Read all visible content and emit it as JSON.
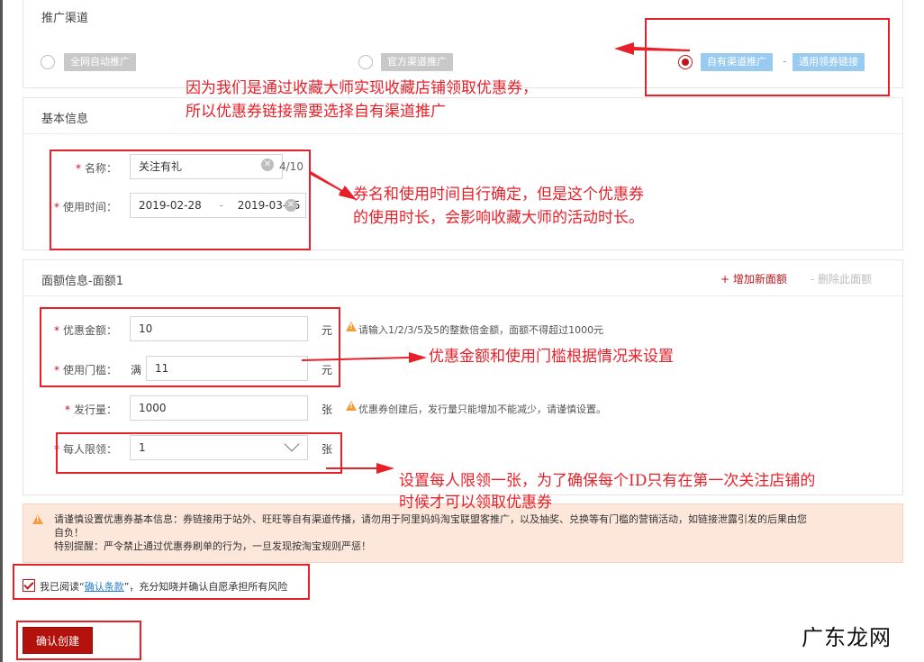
{
  "channel": {
    "title": "推广渠道",
    "options": [
      {
        "label": "全网自动推广",
        "selected": false
      },
      {
        "label": "官方渠道推广",
        "selected": false
      },
      {
        "label": "自有渠道推广",
        "selected": true
      }
    ],
    "sub_option": "通用领券链接",
    "separator": "-"
  },
  "basic": {
    "title": "基本信息",
    "name_label": "名称：",
    "name_value": "关注有礼",
    "name_count": "4/10",
    "time_label": "使用时间：",
    "time_start": "2019-02-28",
    "time_sep": "-",
    "time_end": "2019-03-25"
  },
  "denomination": {
    "title": "面额信息-面额1",
    "add_link": "+ 增加新面额",
    "remove_link": "- 删除此面额",
    "amount_label": "优惠金额：",
    "amount_value": "10",
    "amount_unit": "元",
    "amount_hint": "请输入1/2/3/5及5的整数倍金额，面额不得超过1000元",
    "threshold_label": "使用门槛：",
    "threshold_prefix": "满",
    "threshold_value": "11",
    "threshold_unit": "元",
    "issue_label": "发行量：",
    "issue_value": "1000",
    "issue_unit": "张",
    "issue_hint": "优惠券创建后，发行量只能增加不能减少，请谨慎设置。",
    "limit_label": "每人限领：",
    "limit_value": "1",
    "limit_unit": "张"
  },
  "notice": {
    "line1": "请谨慎设置优惠券基本信息：券链接用于站外、旺旺等自有渠道传播，请勿用于阿里妈妈淘宝联盟客推广，以及抽奖、兑换等有门槛的营销活动，如链接泄露引发的后果由您",
    "line2": "自负！",
    "line3": "特别提醒：严令禁止通过优惠券刷单的行为，一旦发现按淘宝规则严惩！"
  },
  "agreement": {
    "prefix": "我已阅读“",
    "link": "确认条款",
    "suffix": "”，充分知晓并确认自愿承担所有风险"
  },
  "submit_label": "确认创建",
  "annotations": {
    "a1_line1": "因为我们是通过收藏大师实现收藏店铺领取优惠券，",
    "a1_line2": "所以优惠券链接需要选择自有渠道推广",
    "a2_line1": "券名和使用时间自行确定，但是这个优惠券",
    "a2_line2": "的使用时长，会影响收藏大师的活动时长。",
    "a3": "优惠金额和使用门槛根据情况来设置",
    "a4_line1": "设置每人限领一张，为了确保每个ID只有在第一次关注店铺的",
    "a4_line2": "时候才可以领取优惠券"
  },
  "watermark": "广东龙网",
  "colors": {
    "accent_red": "#c0161b",
    "annotation_red": "#e8202a",
    "tag_blue": "#99cbf0",
    "notice_bg": "#fde7da"
  }
}
